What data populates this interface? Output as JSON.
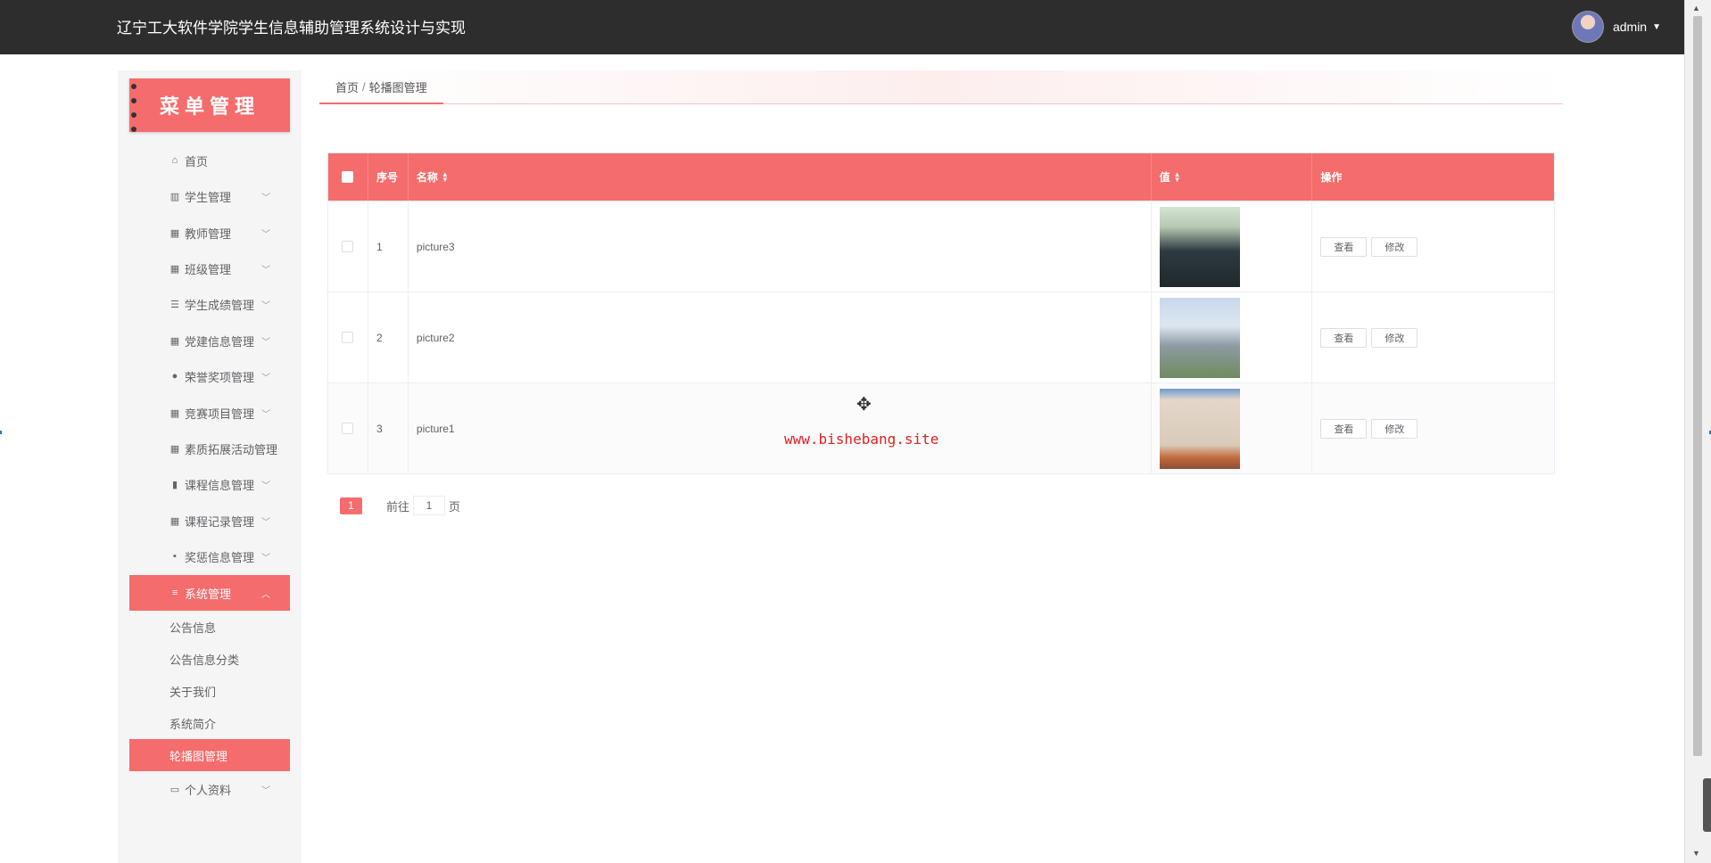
{
  "app": {
    "title": "辽宁工大软件学院学生信息辅助管理系统设计与实现"
  },
  "user": {
    "name": "admin"
  },
  "sidebar": {
    "banner": "菜单管理",
    "items": [
      {
        "label": "首页",
        "icon": "home-icon"
      },
      {
        "label": "学生管理",
        "icon": "book-icon"
      },
      {
        "label": "教师管理",
        "icon": "grid-icon"
      },
      {
        "label": "班级管理",
        "icon": "grid-icon"
      },
      {
        "label": "学生成绩管理",
        "icon": "sliders-icon"
      },
      {
        "label": "党建信息管理",
        "icon": "grid-icon"
      },
      {
        "label": "荣誉奖项管理",
        "icon": "location-icon"
      },
      {
        "label": "竞赛项目管理",
        "icon": "grid-icon"
      },
      {
        "label": "素质拓展活动管理",
        "icon": "grid-icon"
      },
      {
        "label": "课程信息管理",
        "icon": "bar-chart-icon"
      },
      {
        "label": "课程记录管理",
        "icon": "grid-icon"
      },
      {
        "label": "奖惩信息管理",
        "icon": "trash-icon"
      },
      {
        "label": "系统管理",
        "icon": "menu-icon"
      }
    ],
    "sub_items": [
      "公告信息",
      "公告信息分类",
      "关于我们",
      "系统简介",
      "轮播图管理"
    ],
    "profile": {
      "label": "个人资料",
      "icon": "id-card-icon"
    }
  },
  "breadcrumb": {
    "home": "首页",
    "separator": "/",
    "current": "轮播图管理"
  },
  "table": {
    "headers": {
      "index": "序号",
      "name": "名称",
      "value": "值",
      "action": "操作"
    },
    "rows": [
      {
        "index": "1",
        "name": "picture3",
        "view": "查看",
        "edit": "修改"
      },
      {
        "index": "2",
        "name": "picture2",
        "view": "查看",
        "edit": "修改"
      },
      {
        "index": "3",
        "name": "picture1",
        "view": "查看",
        "edit": "修改"
      }
    ]
  },
  "pagination": {
    "current_page": "1",
    "goto_label": "前往",
    "goto_value": "1",
    "page_suffix": "页"
  },
  "watermark": "www.bishebang.site",
  "colors": {
    "accent": "#f56c6c",
    "topbar": "#2d2d2d"
  }
}
